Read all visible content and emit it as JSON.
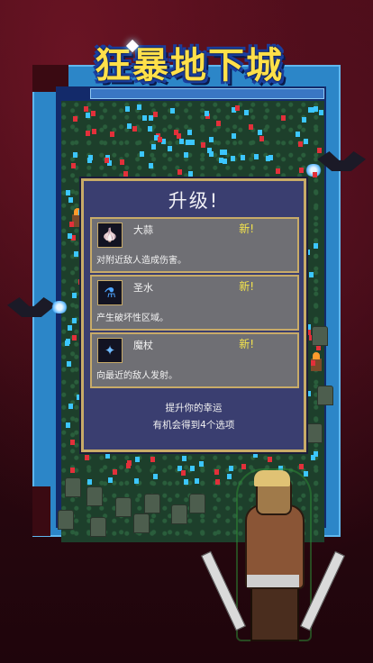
{
  "game": {
    "title": "狂暴地下城"
  },
  "level_up": {
    "title": "升级!",
    "options": [
      {
        "icon": "garlic-icon",
        "name": "大蒜",
        "new_badge": "新!",
        "description": "对附近敌人造成伤害。"
      },
      {
        "icon": "holy-water-icon",
        "name": "圣水",
        "new_badge": "新!",
        "description": "产生破坏性区域。"
      },
      {
        "icon": "magic-wand-icon",
        "name": "魔杖",
        "new_badge": "新!",
        "description": "向最近的敌人发射。"
      }
    ],
    "footer_line1": "提升你的幸运",
    "footer_line2": "有机会得到4个选项"
  },
  "colors": {
    "panel_bg": "#3a3e70",
    "panel_border": "#c8ab68",
    "option_bg": "#6f6f74",
    "new_badge": "#f4e44c",
    "map_frame": "#2c86c8",
    "grass": "#1d3f2b"
  }
}
